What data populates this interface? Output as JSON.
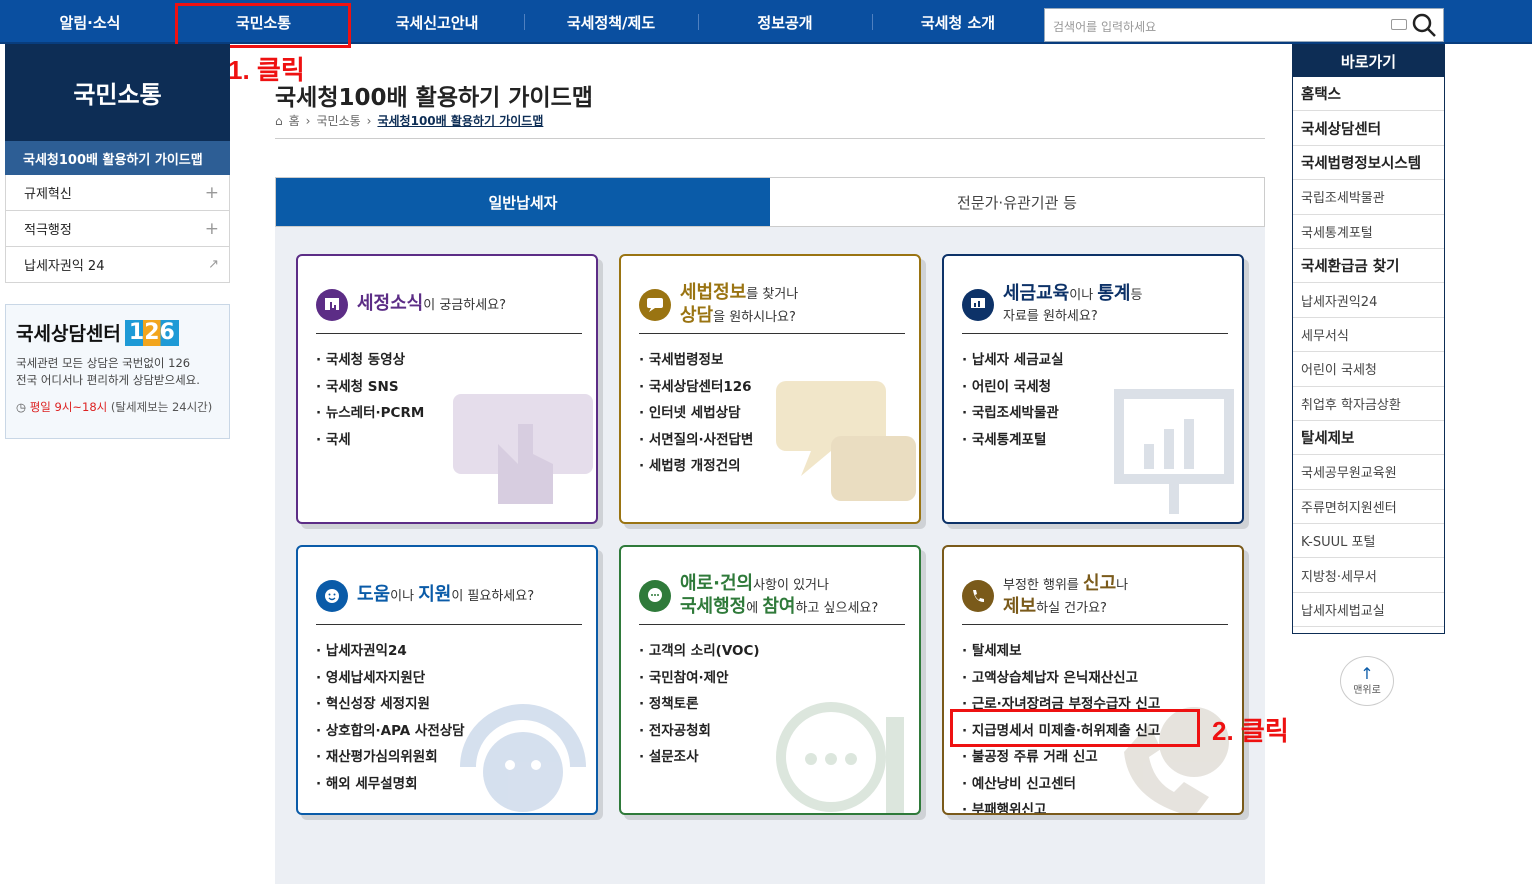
{
  "nav": {
    "items": [
      "알림·소식",
      "국민소통",
      "국세신고안내",
      "국세정책/제도",
      "정보공개",
      "국세청 소개"
    ],
    "search_placeholder": "검색어를 입력하세요"
  },
  "annotations": {
    "step1": "1. 클릭",
    "step2": "2. 클릭"
  },
  "left": {
    "title": "국민소통",
    "active": "국세청100배 활용하기 가이드맵",
    "items": [
      {
        "label": "규제혁신",
        "suffix": "+"
      },
      {
        "label": "적극행정",
        "suffix": "+"
      },
      {
        "label": "납세자권익 24",
        "suffix": "↗"
      }
    ],
    "center": {
      "title": "국세상담센터",
      "number": "126",
      "desc1": "국세관련 모든 상담은 국번없이 126",
      "desc2": "전국 어디서나 편리하게 상담받으세요.",
      "hours": "평일 9시~18시",
      "hours_note": "(탈세제보는 24시간)"
    }
  },
  "page": {
    "title": "국세청100배 활용하기 가이드맵",
    "breadcrumb": [
      "홈",
      "국민소통",
      "국세청100배 활용하기 가이드맵"
    ]
  },
  "tabs": [
    "일반납세자",
    "전문가·유관기관 등"
  ],
  "cards": [
    {
      "color": "#5c2d86",
      "h1": "세정소식",
      "h1s": "이 궁금하세요?",
      "items": [
        "국세청 동영상",
        "국세청 SNS",
        "뉴스레터·PCRM",
        "국세"
      ]
    },
    {
      "color": "#9a7412",
      "h1": "세법정보",
      "h1s": "를 찾거나",
      "h2": "상담",
      "h2s": "을 원하시나요?",
      "items": [
        "국세법령정보",
        "국세상담센터126",
        "인터넷 세법상담",
        "서면질의·사전답변",
        "세법령 개정건의"
      ]
    },
    {
      "color": "#0d3268",
      "h1": "세금교육",
      "h1s": "이나 ",
      "h1b": "통계",
      "h1c": "등",
      "line2": "자료를 원하세요?",
      "items": [
        "납세자 세금교실",
        "어린이 국세청",
        "국립조세박물관",
        "국세통계포털"
      ]
    },
    {
      "color": "#0a5ba8",
      "h1": "도움",
      "h1s": "이나 ",
      "h1b": "지원",
      "h1c": "이 필요하세요?",
      "items": [
        "납세자권익24",
        "영세납세자지원단",
        "혁신성장 세정지원",
        "상호합의·APA 사전상담",
        "재산평가심의위원회",
        "해외 세무설명회"
      ]
    },
    {
      "color": "#2f7a3a",
      "h1": "애로·건의",
      "h1s": "사항이 있거나",
      "h2": "국세행정",
      "h2s": "에 ",
      "h2b": "참여",
      "h2c": "하고 싶으세요?",
      "items": [
        "고객의 소리(VOC)",
        "국민참여·제안",
        "정책토론",
        "전자공청회",
        "설문조사"
      ]
    },
    {
      "color": "#7a5a1a",
      "pre": "부정한 행위를 ",
      "h1": "신고",
      "h1s": "나",
      "h2": "제보",
      "h2s": "하실 건가요?",
      "items": [
        "탈세제보",
        "고액상습체납자 은닉재산신고",
        "근로·자녀장려금 부정수급자 신고",
        "지급명세서 미제출·허위제출 신고",
        "불공정 주류 거래 신고",
        "예산낭비 신고센터",
        "부패행위신고"
      ]
    }
  ],
  "quick": {
    "title": "바로가기",
    "items": [
      {
        "label": "홈택스",
        "bold": true
      },
      {
        "label": "국세상담센터",
        "bold": true
      },
      {
        "label": "국세법령정보시스템",
        "bold": true
      },
      {
        "label": "국립조세박물관",
        "bold": false
      },
      {
        "label": "국세통계포털",
        "bold": false
      },
      {
        "label": "국세환급금 찾기",
        "bold": true
      },
      {
        "label": "납세자권익24",
        "bold": false
      },
      {
        "label": "세무서식",
        "bold": false
      },
      {
        "label": "어린이 국세청",
        "bold": false
      },
      {
        "label": "취업후 학자금상환",
        "bold": false
      },
      {
        "label": "탈세제보",
        "bold": true
      },
      {
        "label": "국세공무원교육원",
        "bold": false
      },
      {
        "label": "주류면허지원센터",
        "bold": false
      },
      {
        "label": "K-SUUL 포털",
        "bold": false
      },
      {
        "label": "지방청·세무서",
        "bold": false
      },
      {
        "label": "납세자세법교실",
        "bold": false
      }
    ],
    "top_label": "맨위로"
  }
}
